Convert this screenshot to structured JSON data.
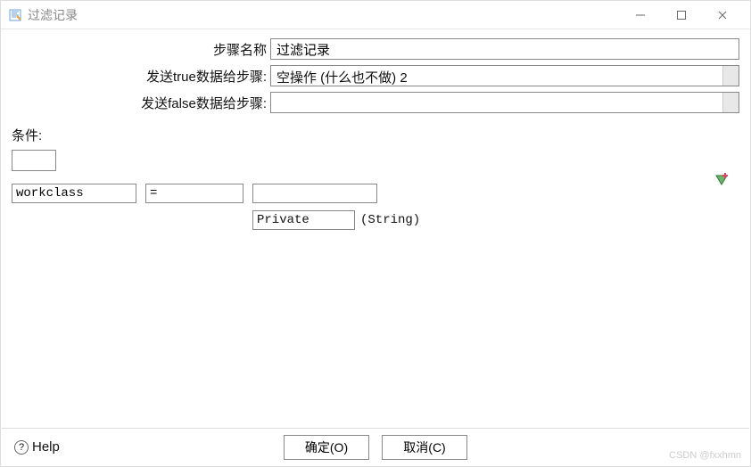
{
  "window": {
    "title": "过滤记录"
  },
  "form": {
    "step_name_label": "步骤名称",
    "step_name_value": "过滤记录",
    "send_true_label": "发送true数据给步骤",
    "send_true_value": "空操作 (什么也不做) 2",
    "send_false_label": "发送false数据给步骤",
    "send_false_value": ""
  },
  "condition": {
    "section_label": "条件:",
    "field": "workclass",
    "operator": "=",
    "value_top": "",
    "value_bottom": "Private",
    "type_hint": "(String)"
  },
  "buttons": {
    "help": "Help",
    "ok": "确定(O)",
    "cancel": "取消(C)"
  },
  "watermark": "CSDN @fxxhmn"
}
